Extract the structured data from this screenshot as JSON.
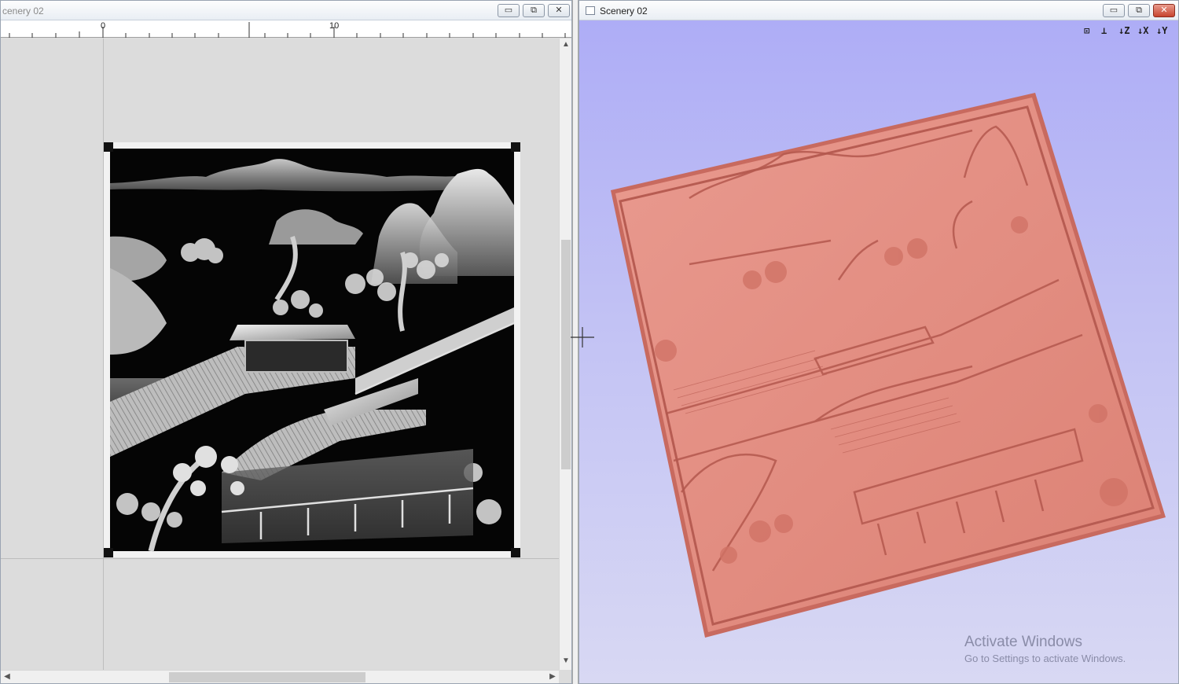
{
  "left_window": {
    "title": "cenery 02",
    "ruler": {
      "label_zero": "0",
      "label_ten": "10"
    },
    "controls": {
      "minimize": "▭",
      "restore": "⧉",
      "close": "✕"
    },
    "scrollbars": {
      "up": "▲",
      "down": "▼",
      "left": "◀",
      "right": "▶"
    }
  },
  "right_window": {
    "title": "Scenery 02",
    "controls": {
      "minimize": "▭",
      "restore": "⧉",
      "close": "✕"
    },
    "toolbar": [
      {
        "name": "zoom-fit-icon",
        "glyph": "⊡"
      },
      {
        "name": "iso-view-icon",
        "glyph": "⊥"
      },
      {
        "name": "view-z-icon",
        "glyph": "↓Z"
      },
      {
        "name": "view-x-icon",
        "glyph": "↓X"
      },
      {
        "name": "view-y-icon",
        "glyph": "↓Y"
      }
    ],
    "watermark": {
      "line1": "Activate Windows",
      "line2": "Go to Settings to activate Windows."
    }
  },
  "colors": {
    "relief_3d": "#e48b7f",
    "relief_3d_edge": "#c86a5f",
    "background_3d_top": "#aeadf6",
    "grayscale_dark": "#0a0a0a",
    "grayscale_light": "#e6e6e6"
  }
}
